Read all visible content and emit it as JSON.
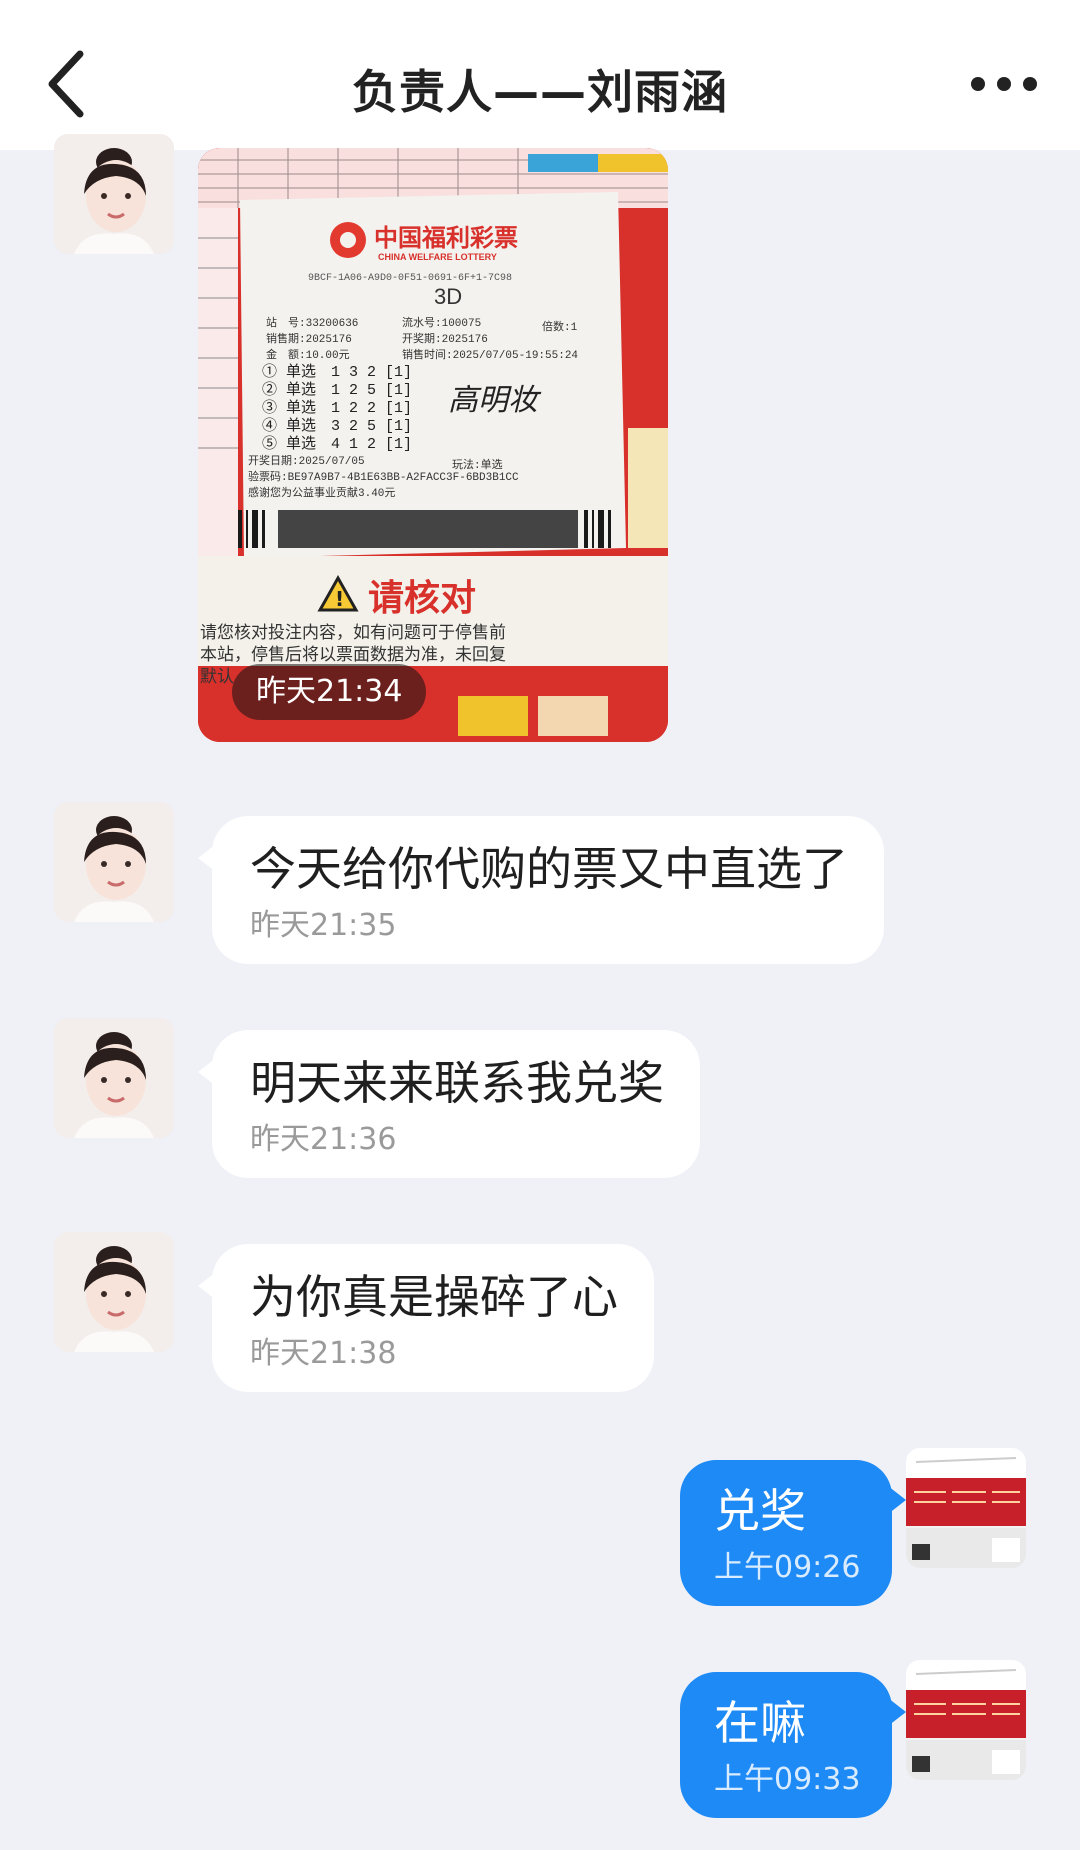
{
  "header": {
    "title": "负责人——刘雨涵"
  },
  "messages": [
    {
      "type": "image",
      "from": "contact",
      "time": "昨天21:34"
    },
    {
      "type": "text",
      "from": "contact",
      "text": "今天给你代购的票又中直选了",
      "time": "昨天21:35"
    },
    {
      "type": "text",
      "from": "contact",
      "text": "明天来来联系我兑奖",
      "time": "昨天21:36"
    },
    {
      "type": "text",
      "from": "contact",
      "text": "为你真是操碎了心",
      "time": "昨天21:38"
    },
    {
      "type": "text",
      "from": "self",
      "text": "兑奖",
      "time": "上午09:26"
    },
    {
      "type": "text",
      "from": "self",
      "text": "在嘛",
      "time": "上午09:33"
    }
  ],
  "ticket": {
    "brand": "中国福利彩票",
    "brand_en": "CHINA WELFARE LOTTERY",
    "code": "9BCF-1A06-A9D0-0F51-0691-6F+1-7C98",
    "game": "3D",
    "station": "站　号:33200636",
    "serial": "流水号:100075",
    "multiple": "倍数:1",
    "sale_period": "销售期:2025176",
    "draw_period": "开奖期:2025176",
    "amount": "金　额:10.00元",
    "sale_time": "销售时间:2025/07/05-19:55:24",
    "lines": [
      "① 单选　1 3 2 [1]",
      "② 单选　1 2 5 [1]",
      "③ 单选　1 2 2 [1]",
      "④ 单选　3 2 5 [1]",
      "⑤ 单选　4 1 2 [1]"
    ],
    "handwriting": "高明妆",
    "draw_date": "开奖日期:2025/07/05",
    "play": "玩法:单选",
    "verify_code": "验票码:BE97A9B7-4B1E63BB-A2FACC3F-6BD3B1CC",
    "thanks": "感谢您为公益事业贡献3.40元",
    "warning": "请核对",
    "notice_1": "请您核对投注内容，如有问题可于停售前",
    "notice_2": "本站，停售后将以票面数据为准，未回复",
    "notice_3": "默认"
  },
  "colors": {
    "accent": "#1e8af5",
    "background": "#eff1f6",
    "bubble_in": "#ffffff"
  },
  "icons": {
    "back": "chevron-left-icon",
    "more": "more-horizontal-icon"
  }
}
